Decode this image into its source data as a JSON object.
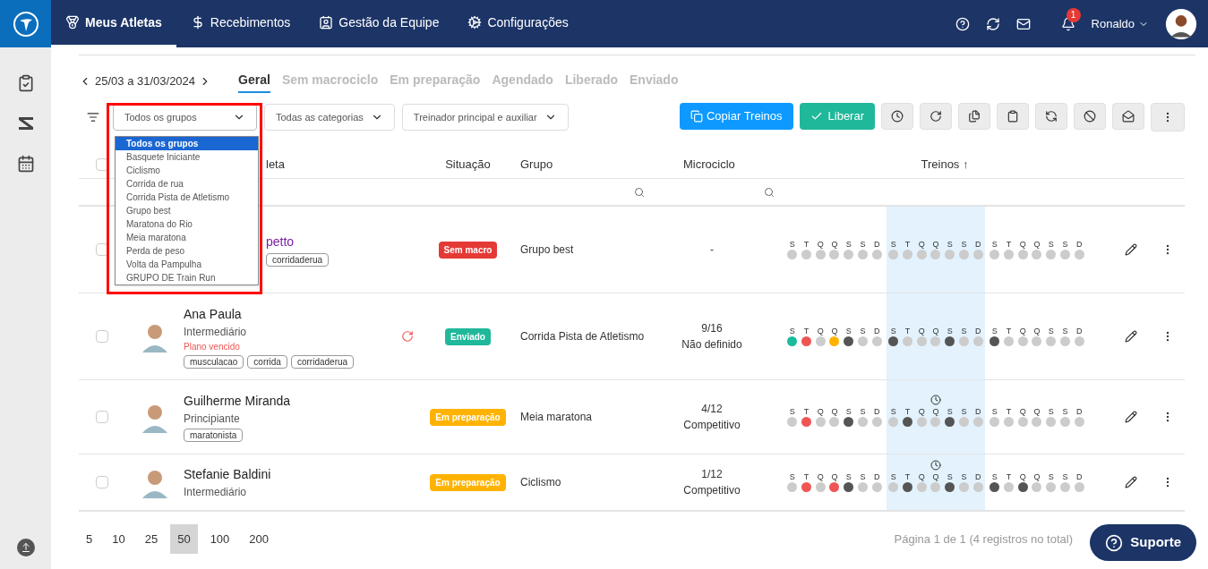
{
  "nav": {
    "items": [
      {
        "label": "Meus Atletas",
        "selected": true,
        "kind": "medal"
      },
      {
        "label": "Recebimentos",
        "selected": false,
        "kind": "dollar"
      },
      {
        "label": "Gestão da Equipe",
        "selected": false,
        "kind": "badge"
      },
      {
        "label": "Configurações",
        "selected": false,
        "kind": "gears"
      }
    ],
    "notifications": "1",
    "user": "Ronaldo"
  },
  "period": {
    "range": "25/03 a 31/03/2024"
  },
  "tabs": [
    {
      "label": "Geral",
      "selected": true
    },
    {
      "label": "Sem macrociclo",
      "selected": false
    },
    {
      "label": "Em preparação",
      "selected": false
    },
    {
      "label": "Agendado",
      "selected": false
    },
    {
      "label": "Liberado",
      "selected": false
    },
    {
      "label": "Enviado",
      "selected": false
    }
  ],
  "filters": [
    {
      "value": "Todos os grupos",
      "open": true
    },
    {
      "value": "Todas as categorias",
      "open": false
    },
    {
      "value": "Treinador principal e auxiliar",
      "open": false
    }
  ],
  "group_options": [
    {
      "label": "Todos os grupos",
      "selected": true
    },
    {
      "label": "Basquete Iniciante",
      "selected": false
    },
    {
      "label": "Ciclismo",
      "selected": false
    },
    {
      "label": "Corrida de rua",
      "selected": false
    },
    {
      "label": "Corrida Pista de Atletismo",
      "selected": false
    },
    {
      "label": "Grupo best",
      "selected": false
    },
    {
      "label": "Maratona do Rio",
      "selected": false
    },
    {
      "label": "Meia maratona",
      "selected": false
    },
    {
      "label": "Perda de peso",
      "selected": false
    },
    {
      "label": "Volta da Pampulha",
      "selected": false
    },
    {
      "label": "GRUPO DE Train Run",
      "selected": false
    }
  ],
  "actions": {
    "copy": "Copiar Treinos",
    "release": "Liberar"
  },
  "table": {
    "all_checked": false,
    "columns": [
      "leta",
      "Situação",
      "Grupo",
      "Microciclo",
      "Treinos ↑"
    ],
    "rows": [
      {
        "checked": false,
        "name": "petto",
        "clipped": true,
        "avatar": false,
        "level": "",
        "alert": "",
        "renew": false,
        "tags": [
          "corridaderua"
        ],
        "status": {
          "label": "Sem macro",
          "kind": "sem_macro"
        },
        "group": "Grupo best",
        "micro": [
          "-"
        ],
        "clock": false,
        "days": [
          {
            "label": "S",
            "color": "#cccccc"
          },
          {
            "label": "T",
            "color": "#cccccc"
          },
          {
            "label": "Q",
            "color": "#cccccc"
          },
          {
            "label": "Q",
            "color": "#cccccc"
          },
          {
            "label": "S",
            "color": "#cccccc"
          },
          {
            "label": "S",
            "color": "#cccccc"
          },
          {
            "label": "D",
            "color": "#cccccc"
          },
          {
            "label": "S",
            "color": "#cccccc"
          },
          {
            "label": "T",
            "color": "#cccccc"
          },
          {
            "label": "Q",
            "color": "#cccccc"
          },
          {
            "label": "Q",
            "color": "#cccccc"
          },
          {
            "label": "S",
            "color": "#cccccc"
          },
          {
            "label": "S",
            "color": "#cccccc"
          },
          {
            "label": "D",
            "color": "#cccccc"
          },
          {
            "label": "S",
            "color": "#cccccc"
          },
          {
            "label": "T",
            "color": "#cccccc"
          },
          {
            "label": "Q",
            "color": "#cccccc"
          },
          {
            "label": "Q",
            "color": "#cccccc"
          },
          {
            "label": "S",
            "color": "#cccccc"
          },
          {
            "label": "S",
            "color": "#cccccc"
          },
          {
            "label": "D",
            "color": "#cccccc"
          }
        ]
      },
      {
        "checked": false,
        "name": "Ana Paula",
        "clipped": false,
        "avatar": true,
        "level": "Intermediário",
        "alert": "Plano vencido",
        "renew": true,
        "tags": [
          "musculacao",
          "corrida",
          "corridaderua"
        ],
        "status": {
          "label": "Enviado",
          "kind": "enviado"
        },
        "group": "Corrida Pista de Atletismo",
        "micro": [
          "9/16",
          "Não definido"
        ],
        "clock": false,
        "days": [
          {
            "label": "S",
            "color": "#1abc9c"
          },
          {
            "label": "T",
            "color": "#f05555"
          },
          {
            "label": "Q",
            "color": "#cccccc"
          },
          {
            "label": "Q",
            "color": "#ffb300"
          },
          {
            "label": "S",
            "color": "#555555"
          },
          {
            "label": "S",
            "color": "#cccccc"
          },
          {
            "label": "D",
            "color": "#cccccc"
          },
          {
            "label": "S",
            "color": "#555555"
          },
          {
            "label": "T",
            "color": "#cccccc"
          },
          {
            "label": "Q",
            "color": "#cccccc"
          },
          {
            "label": "Q",
            "color": "#cccccc"
          },
          {
            "label": "S",
            "color": "#555555"
          },
          {
            "label": "S",
            "color": "#cccccc"
          },
          {
            "label": "D",
            "color": "#cccccc"
          },
          {
            "label": "S",
            "color": "#555555"
          },
          {
            "label": "T",
            "color": "#cccccc"
          },
          {
            "label": "Q",
            "color": "#cccccc"
          },
          {
            "label": "Q",
            "color": "#cccccc"
          },
          {
            "label": "S",
            "color": "#cccccc"
          },
          {
            "label": "S",
            "color": "#cccccc"
          },
          {
            "label": "D",
            "color": "#cccccc"
          }
        ]
      },
      {
        "checked": false,
        "name": "Guilherme Miranda",
        "clipped": false,
        "avatar": true,
        "level": "Principiante",
        "alert": "",
        "renew": false,
        "tags": [
          "maratonista"
        ],
        "status": {
          "label": "Em preparação",
          "kind": "em_preparacao"
        },
        "group": "Meia maratona",
        "micro": [
          "4/12",
          "Competitivo"
        ],
        "clock": true,
        "days": [
          {
            "label": "S",
            "color": "#cccccc"
          },
          {
            "label": "T",
            "color": "#f05555"
          },
          {
            "label": "Q",
            "color": "#cccccc"
          },
          {
            "label": "Q",
            "color": "#cccccc"
          },
          {
            "label": "S",
            "color": "#555555"
          },
          {
            "label": "S",
            "color": "#cccccc"
          },
          {
            "label": "D",
            "color": "#cccccc"
          },
          {
            "label": "S",
            "color": "#cccccc"
          },
          {
            "label": "T",
            "color": "#555555"
          },
          {
            "label": "Q",
            "color": "#cccccc"
          },
          {
            "label": "Q",
            "color": "#cccccc"
          },
          {
            "label": "S",
            "color": "#555555"
          },
          {
            "label": "S",
            "color": "#cccccc"
          },
          {
            "label": "D",
            "color": "#cccccc"
          },
          {
            "label": "S",
            "color": "#cccccc"
          },
          {
            "label": "T",
            "color": "#cccccc"
          },
          {
            "label": "Q",
            "color": "#cccccc"
          },
          {
            "label": "Q",
            "color": "#cccccc"
          },
          {
            "label": "S",
            "color": "#cccccc"
          },
          {
            "label": "S",
            "color": "#cccccc"
          },
          {
            "label": "D",
            "color": "#cccccc"
          }
        ]
      },
      {
        "checked": false,
        "name": "Stefanie Baldini",
        "clipped": false,
        "avatar": true,
        "level": "Intermediário",
        "alert": "",
        "renew": false,
        "tags": [],
        "status": {
          "label": "Em preparação",
          "kind": "em_preparacao"
        },
        "group": "Ciclismo",
        "micro": [
          "1/12",
          "Competitivo"
        ],
        "clock": true,
        "days": [
          {
            "label": "S",
            "color": "#cccccc"
          },
          {
            "label": "T",
            "color": "#f05555"
          },
          {
            "label": "Q",
            "color": "#cccccc"
          },
          {
            "label": "Q",
            "color": "#f05555"
          },
          {
            "label": "S",
            "color": "#555555"
          },
          {
            "label": "S",
            "color": "#cccccc"
          },
          {
            "label": "D",
            "color": "#cccccc"
          },
          {
            "label": "S",
            "color": "#cccccc"
          },
          {
            "label": "T",
            "color": "#555555"
          },
          {
            "label": "Q",
            "color": "#cccccc"
          },
          {
            "label": "Q",
            "color": "#cccccc"
          },
          {
            "label": "S",
            "color": "#555555"
          },
          {
            "label": "S",
            "color": "#cccccc"
          },
          {
            "label": "D",
            "color": "#cccccc"
          },
          {
            "label": "S",
            "color": "#555555"
          },
          {
            "label": "T",
            "color": "#cccccc"
          },
          {
            "label": "Q",
            "color": "#555555"
          },
          {
            "label": "Q",
            "color": "#cccccc"
          },
          {
            "label": "S",
            "color": "#cccccc"
          },
          {
            "label": "S",
            "color": "#cccccc"
          },
          {
            "label": "D",
            "color": "#cccccc"
          }
        ]
      }
    ]
  },
  "page_sizes": [
    {
      "label": "5",
      "selected": false
    },
    {
      "label": "10",
      "selected": false
    },
    {
      "label": "25",
      "selected": false
    },
    {
      "label": "50",
      "selected": true
    },
    {
      "label": "100",
      "selected": false
    },
    {
      "label": "200",
      "selected": false
    }
  ],
  "pagination": "Página 1 de 1 (4 registros no total)",
  "support": "Suporte"
}
